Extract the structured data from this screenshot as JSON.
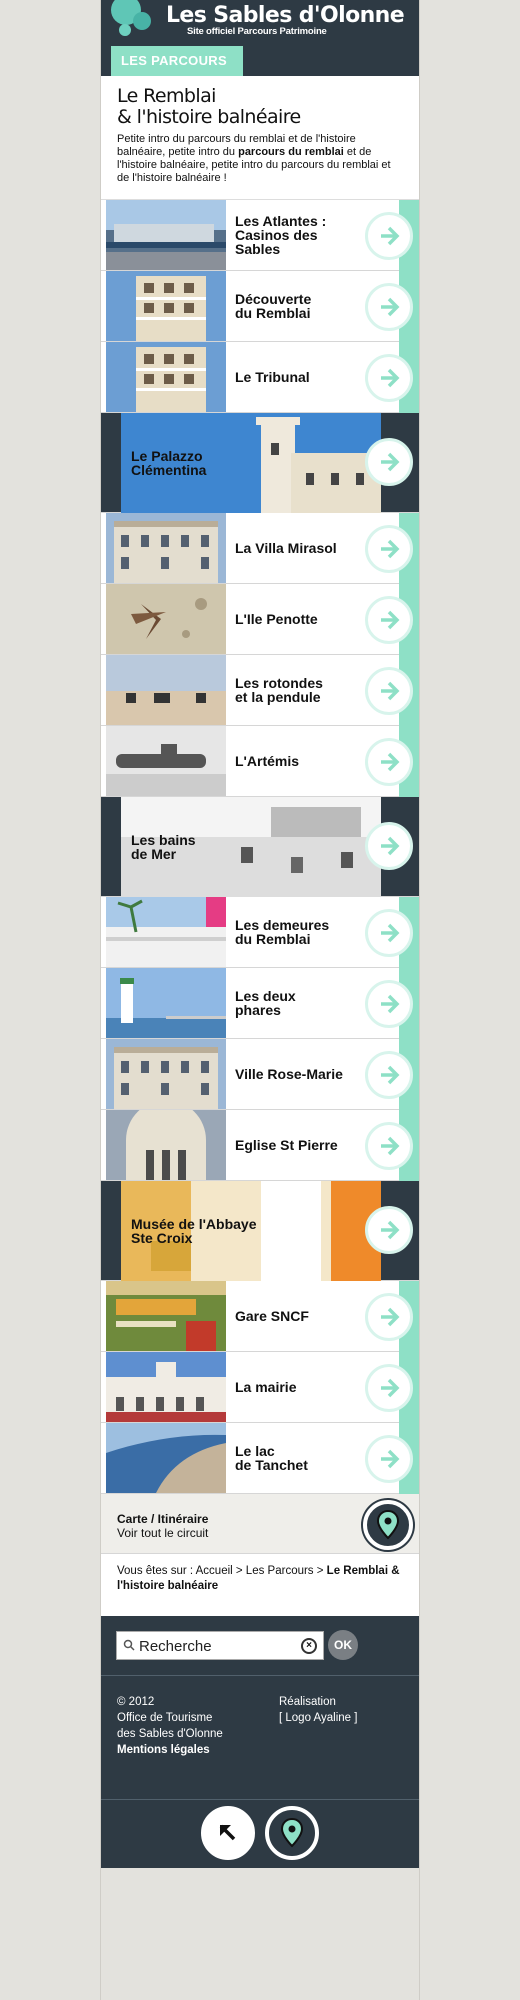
{
  "header": {
    "brand_title": "Les Sables d'Olonne",
    "brand_subtitle": "Site officiel Parcours Patrimoine",
    "section_tab": "LES PARCOURS"
  },
  "intro": {
    "title_line1": "Le Remblai",
    "title_line2": "& l'histoire balnéaire",
    "text_a": "Petite intro du parcours du remblai et de l'histoire balnéaire, petite intro du ",
    "text_bold": "parcours du remblai",
    "text_b": " et de l'histoire balnéaire, petite intro du parcours du remblai et de l'histoire balnéaire !"
  },
  "items": [
    {
      "label": "Les Atlantes :\nCasinos des\nSables",
      "image": "casino-photo"
    },
    {
      "label": "Découverte\ndu Remblai",
      "image": "building-photo"
    },
    {
      "label": "Le Tribunal",
      "image": "building-photo"
    },
    {
      "label": "Le Palazzo\nClémentina",
      "image": "palace-photo",
      "featured": true
    },
    {
      "label": "La Villa Mirasol",
      "image": "villa-photo"
    },
    {
      "label": "L'Ile Penotte",
      "image": "shell-mosaic-photo"
    },
    {
      "label": "Les rotondes\net la pendule",
      "image": "promenade-photo"
    },
    {
      "label": "L'Artémis",
      "image": "submarine-photo"
    },
    {
      "label": "Les bains\nde Mer",
      "image": "beach-photo",
      "featured": true
    },
    {
      "label": "Les demeures\ndu Remblai",
      "image": "terrace-photo"
    },
    {
      "label": "Les deux\nphares",
      "image": "lighthouse-photo"
    },
    {
      "label": "Ville Rose-Marie",
      "image": "villa-photo"
    },
    {
      "label": "Eglise St Pierre",
      "image": "church-photo"
    },
    {
      "label": "Musée de l'Abbaye\nSte Croix",
      "image": "museum-photo",
      "featured": true
    },
    {
      "label": "Gare SNCF",
      "image": "poster-photo"
    },
    {
      "label": "La mairie",
      "image": "townhall-photo"
    },
    {
      "label": "Le lac\nde Tanchet",
      "image": "coast-photo"
    }
  ],
  "map_link": {
    "title": "Carte / Itinéraire",
    "subtitle": "Voir tout le circuit"
  },
  "breadcrumb": {
    "prefix": "Vous êtes sur : Accueil > Les Parcours > ",
    "current": "Le Remblai & l'histoire balnéaire"
  },
  "search": {
    "value": "Recherche",
    "ok_label": "OK"
  },
  "footer": {
    "year": "© 2012",
    "org_line1": "Office de Tourisme",
    "org_line2": "des Sables d'Olonne",
    "legal": "Mentions légales",
    "credit_label": "Réalisation",
    "credit_logo": "[ Logo Ayaline ]"
  },
  "colors": {
    "dark": "#2e3a44",
    "accent": "#8ee0c6"
  }
}
